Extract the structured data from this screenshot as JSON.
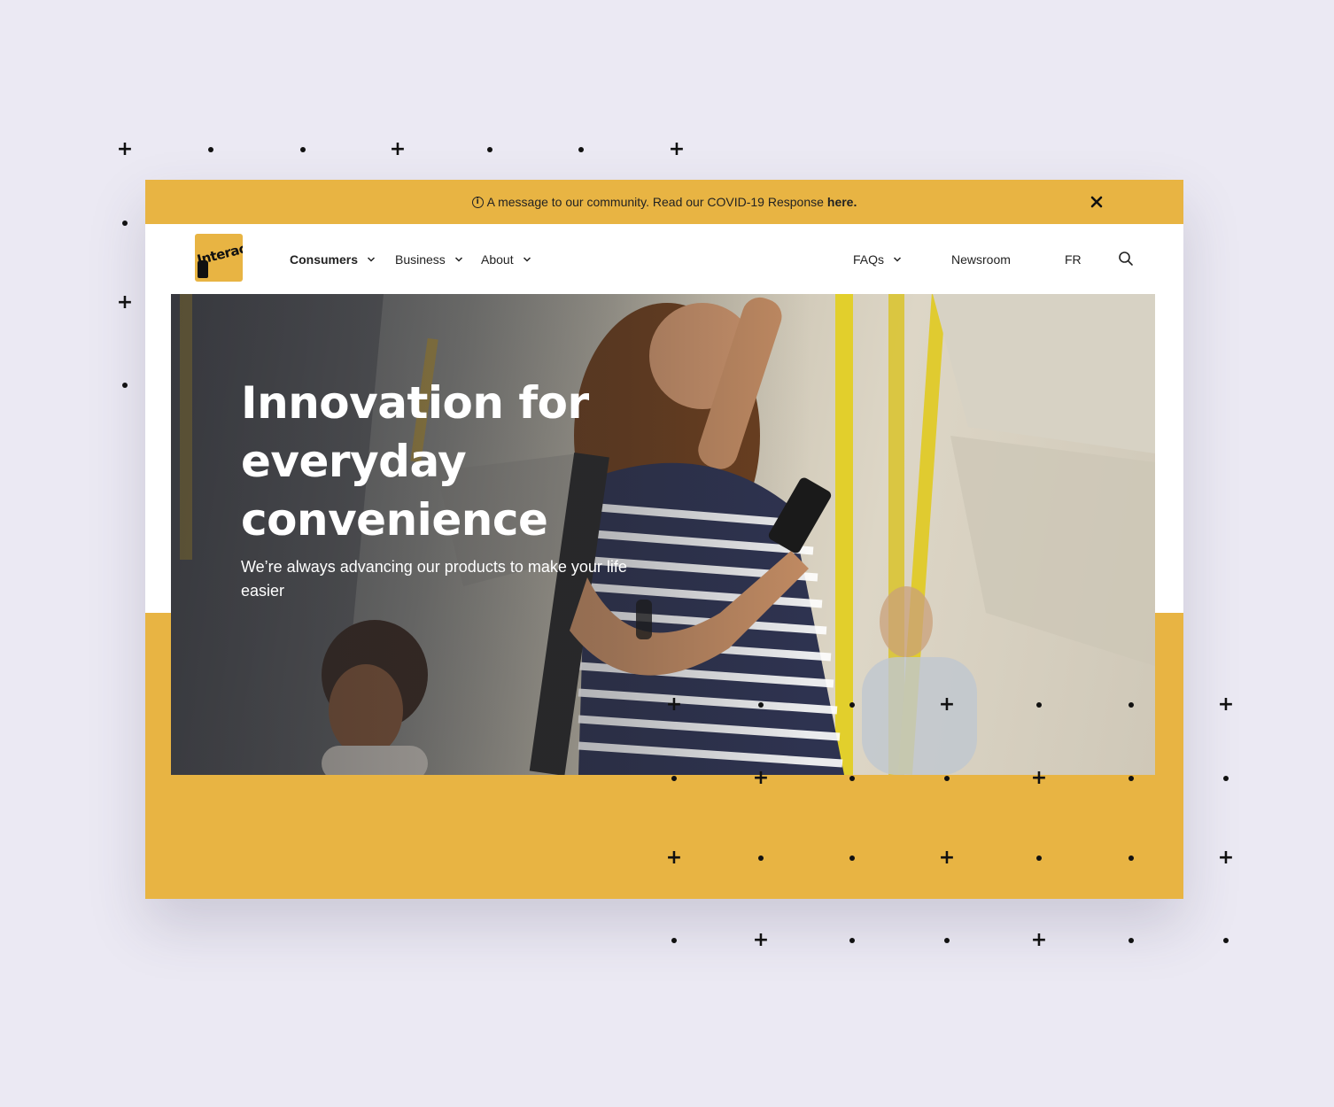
{
  "banner": {
    "message": "A message to our community. Read our COVID-19 Response",
    "link": "here."
  },
  "logo": {
    "text": "Interac"
  },
  "nav": {
    "left": [
      {
        "label": "Consumers"
      },
      {
        "label": "Business"
      },
      {
        "label": "About"
      }
    ],
    "right": [
      {
        "label": "FAQs"
      },
      {
        "label": "Newsroom"
      },
      {
        "label": "FR"
      }
    ]
  },
  "hero": {
    "title": "Innovation for everyday convenience",
    "subtitle": "We’re always advancing our products to make your life easier"
  },
  "colors": {
    "brand_yellow": "#e8b443",
    "page_background": "#ebe9f3",
    "text": "#222222"
  },
  "icons": [
    "info-icon",
    "close-icon",
    "chevron-down-icon",
    "search-icon"
  ]
}
